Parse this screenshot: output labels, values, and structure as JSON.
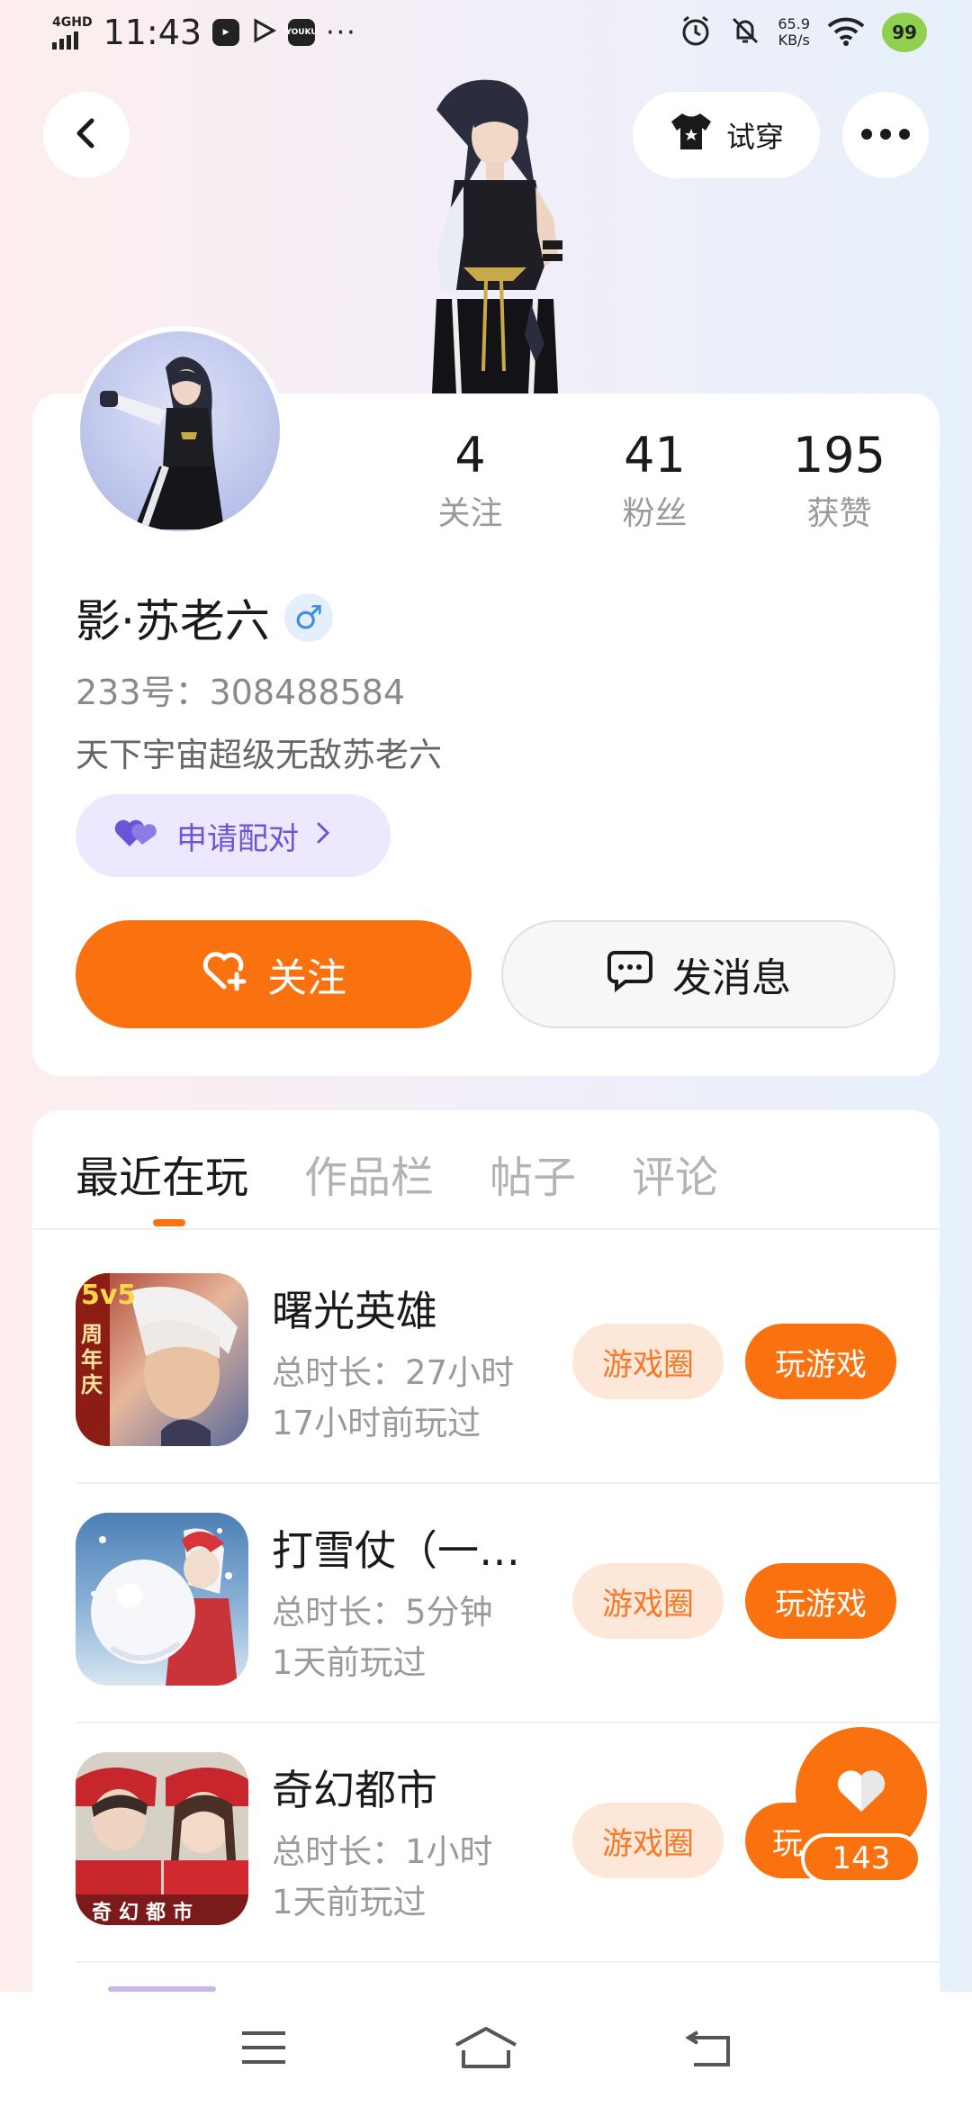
{
  "status_bar": {
    "network": "4GHD",
    "time": "11:43",
    "app_icons": [
      "media-icon",
      "play-icon",
      "youku-icon"
    ],
    "youku_label": "YOUKU",
    "more": "···",
    "speed_value": "65.9",
    "speed_unit": "KB/s",
    "battery": "99"
  },
  "header": {
    "tryon_label": "试穿"
  },
  "profile": {
    "stats": [
      {
        "value": "4",
        "label": "关注"
      },
      {
        "value": "41",
        "label": "粉丝"
      },
      {
        "value": "195",
        "label": "获赞"
      }
    ],
    "username": "影·苏老六",
    "gender_symbol": "♂",
    "uid": "233号：308488584",
    "bio": "天下宇宙超级无敌苏老六",
    "pair_label": "申请配对",
    "follow_label": "关注",
    "message_label": "发消息"
  },
  "tabs": [
    {
      "label": "最近在玩",
      "active": true
    },
    {
      "label": "作品栏",
      "active": false
    },
    {
      "label": "帖子",
      "active": false
    },
    {
      "label": "评论",
      "active": false
    }
  ],
  "games": [
    {
      "name": "曙光英雄",
      "duration": "总时长：27小时",
      "last_played": "17小时前玩过",
      "circle_label": "游戏圈",
      "play_label": "玩游戏",
      "icon_badge": "5v5",
      "icon_side": "周年庆"
    },
    {
      "name": "打雪仗（一…",
      "duration": "总时长：5分钟",
      "last_played": "1天前玩过",
      "circle_label": "游戏圈",
      "play_label": "玩游戏"
    },
    {
      "name": "奇幻都市",
      "duration": "总时长：1小时",
      "last_played": "1天前玩过",
      "circle_label": "游戏圈",
      "play_label": "玩",
      "icon_caption": "奇幻都市"
    }
  ],
  "like_float": {
    "count": "143"
  },
  "colors": {
    "accent": "#f9720f",
    "pair_purple": "#6a55d8"
  }
}
